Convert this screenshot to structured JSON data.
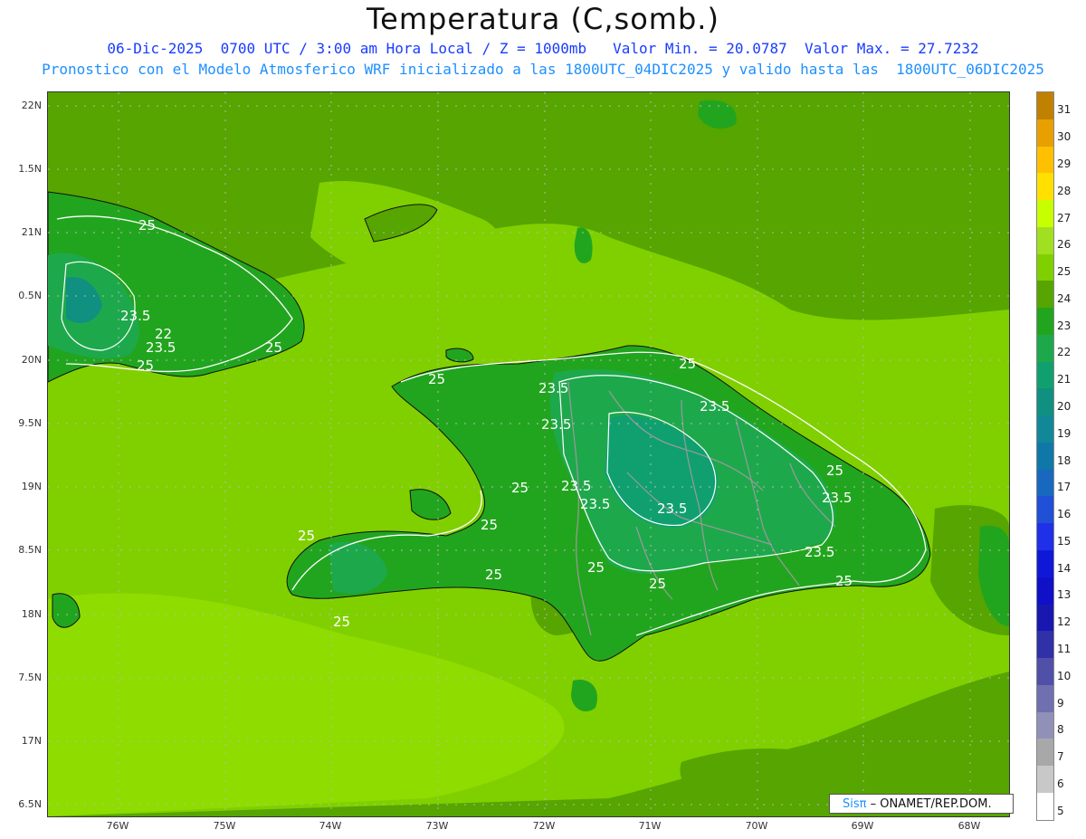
{
  "header": {
    "title": "Temperatura (C,somb.)",
    "line1": "06-Dic-2025  0700 UTC / 3:00 am Hora Local / Z = 1000mb   Valor Min. = 20.0787  Valor Max. = 27.7232",
    "line2": "Pronostico con el Modelo Atmosferico WRF inicializado a las 1800UTC_04DIC2025 y valido hasta las  1800UTC_06DIC2025"
  },
  "axes": {
    "lat_labels": [
      "22N",
      "1.5N",
      "21N",
      "0.5N",
      "20N",
      "9.5N",
      "19N",
      "8.5N",
      "18N",
      "7.5N",
      "17N",
      "6.5N"
    ],
    "lon_labels": [
      "76W",
      "75W",
      "74W",
      "73W",
      "72W",
      "71W",
      "70W",
      "69W",
      "68W"
    ]
  },
  "contour_labels": [
    "25",
    "23.5",
    "22",
    "23.5",
    "25",
    "25",
    "23.5",
    "23.5",
    "25",
    "23.5",
    "23.5",
    "23.5",
    "23.5",
    "25",
    "25",
    "25",
    "25",
    "25",
    "25",
    "23.5",
    "25",
    "25",
    "25",
    "23.5",
    "25"
  ],
  "colorbar": {
    "levels": [
      "31",
      "30",
      "29",
      "28",
      "27",
      "26",
      "25",
      "24",
      "23",
      "22",
      "21",
      "20",
      "19",
      "18",
      "17",
      "16",
      "15",
      "14",
      "13",
      "12",
      "11",
      "10",
      "9",
      "8",
      "7",
      "6",
      "5"
    ],
    "colors": [
      "#c08000",
      "#e8a000",
      "#ffc000",
      "#ffe000",
      "#c8ff00",
      "#a0e020",
      "#80d000",
      "#56a500",
      "#22a51e",
      "#1ea84c",
      "#10a070",
      "#109080",
      "#108898",
      "#1078a8",
      "#1868c0",
      "#2050d8",
      "#2030e8",
      "#1018d8",
      "#1010c8",
      "#1818b0",
      "#3030a8",
      "#5050a8",
      "#7070b0",
      "#9090b8",
      "#a8a8a8",
      "#c8c8c8",
      "#ffffff"
    ]
  },
  "credit": {
    "brand": "Sisπ",
    "text": "– ONAMET/REP.DOM."
  }
}
